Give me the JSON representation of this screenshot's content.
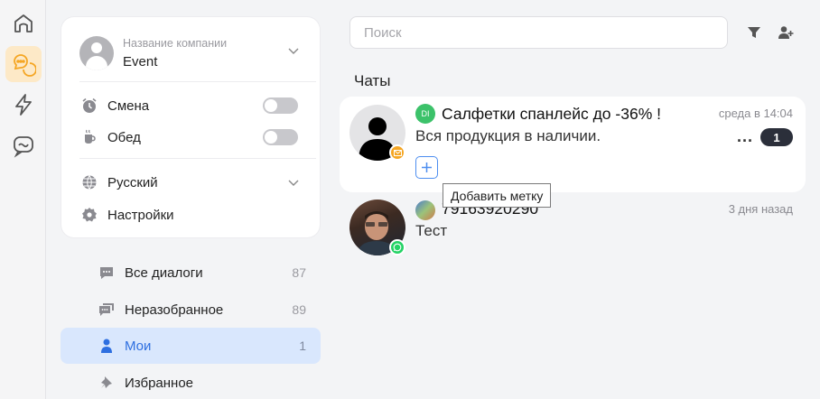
{
  "rail": {
    "items": [
      {
        "icon": "home-icon"
      },
      {
        "icon": "chats-icon",
        "active": true
      },
      {
        "icon": "lightning-icon"
      },
      {
        "icon": "message-icon"
      }
    ],
    "accent": "#f5a623"
  },
  "sidebar": {
    "company_label": "Название компании",
    "company_name": "Event",
    "shift_label": "Смена",
    "lunch_label": "Обед",
    "language_label": "Русский",
    "settings_label": "Настройки",
    "nav": [
      {
        "label": "Все диалоги",
        "count": "87"
      },
      {
        "label": "Неразобранное",
        "count": "89"
      },
      {
        "label": "Мои",
        "count": "1",
        "active": true
      },
      {
        "label": "Избранное",
        "count": ""
      }
    ]
  },
  "main": {
    "search_placeholder": "Поиск",
    "section_title": "Чаты",
    "chats": [
      {
        "avatar_initials": "DI",
        "title": "Салфетки спанлейс до -36% !",
        "time": "среда в 14:04",
        "message": "Вся продукция в наличии.",
        "unread": "1",
        "source": "email",
        "selected": true
      },
      {
        "title": "79163920290",
        "time": "3 дня назад",
        "message": "Тест",
        "source": "whatsapp"
      }
    ],
    "tooltip": "Добавить метку"
  },
  "colors": {
    "active_nav_bg": "#d9e7fd",
    "active_nav_text": "#2e6fe0",
    "whatsapp": "#25d366",
    "email_badge": "#f5a623",
    "initials_badge": "#3cc26a"
  }
}
